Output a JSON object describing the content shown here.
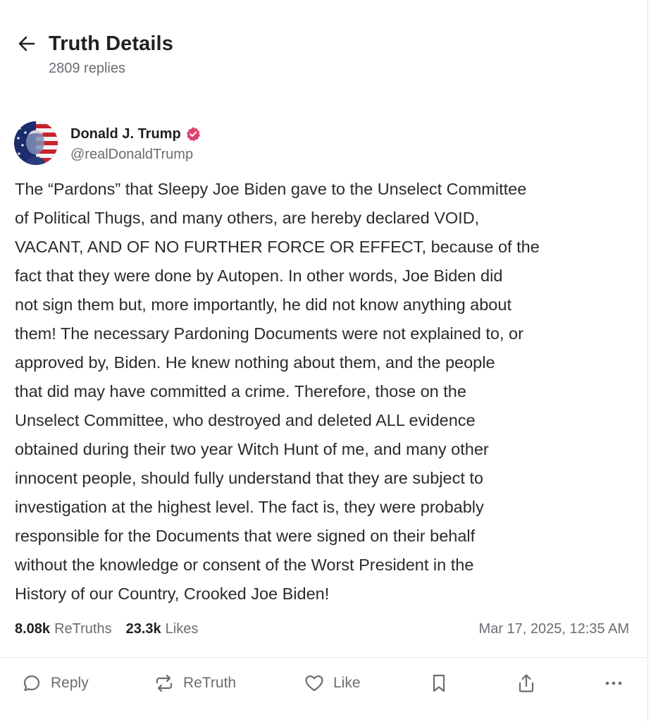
{
  "header": {
    "title": "Truth Details",
    "reply_count": "2809 replies",
    "back_icon": "arrow-left-icon"
  },
  "author": {
    "name": "Donald J. Trump",
    "handle": "@realDonaldTrump",
    "verified_color": "#e2416f"
  },
  "post": {
    "lines": [
      "The “Pardons” that Sleepy Joe Biden gave to the Unselect Committee",
      "of Political Thugs, and many others, are hereby declared VOID,",
      "VACANT, AND OF NO FURTHER FORCE OR EFFECT, because of the",
      "fact that they were done by Autopen. In other words, Joe Biden did",
      "not sign them but, more importantly, he did not know anything about",
      "them! The necessary Pardoning Documents were not explained to, or",
      "approved by, Biden. He knew nothing about them, and the people",
      "that did may have committed a crime. Therefore, those on the",
      "Unselect Committee, who destroyed and deleted ALL evidence",
      "obtained during their two year Witch Hunt of me, and many other",
      "innocent people, should fully understand that they are subject to",
      "investigation at the highest level. The fact is, they were probably",
      "responsible for the Documents that were signed on their behalf",
      "without the knowledge or consent of the Worst President in the",
      "History of our Country, Crooked Joe Biden!"
    ]
  },
  "stats": {
    "retruths_count": "8.08k",
    "retruths_label": "ReTruths",
    "likes_count": "23.3k",
    "likes_label": "Likes",
    "timestamp": "Mar 17, 2025, 12:35 AM"
  },
  "actions": {
    "reply_label": "Reply",
    "retruth_label": "ReTruth",
    "like_label": "Like",
    "icons": [
      "reply-icon",
      "retruth-icon",
      "like-icon",
      "bookmark-icon",
      "share-icon",
      "more-icon"
    ]
  },
  "colors": {
    "text": "#1f1f24",
    "muted": "#6b6b73",
    "divider": "#e8e8ec"
  }
}
